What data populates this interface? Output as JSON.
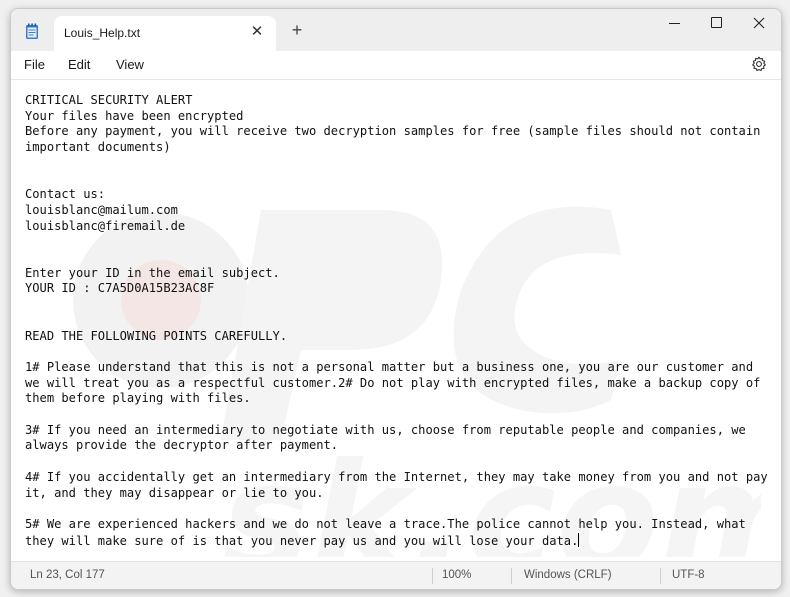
{
  "tab": {
    "title": "Louis_Help.txt"
  },
  "menu": {
    "file": "File",
    "edit": "Edit",
    "view": "View"
  },
  "editor": {
    "lines": [
      "CRITICAL SECURITY ALERT",
      "Your files have been encrypted",
      "Before any payment, you will receive two decryption samples for free (sample files should not contain",
      "important documents)",
      "",
      "",
      "Contact us:",
      "louisblanc@mailum.com",
      "louisblanc@firemail.de",
      "",
      "",
      "Enter your ID in the email subject.",
      "YOUR ID : C7A5D0A15B23AC8F",
      "",
      "",
      "READ THE FOLLOWING POINTS CAREFULLY.",
      "",
      "1# Please understand that this is not a personal matter but a business one, you are our customer and",
      "we will treat you as a respectful customer.2# Do not play with encrypted files, make a backup copy of",
      "them before playing with files.",
      "",
      "3# If you need an intermediary to negotiate with us, choose from reputable people and companies, we",
      "always provide the decryptor after payment.",
      "",
      "4# If you accidentally get an intermediary from the Internet, they may take money from you and not pay",
      "it, and they may disappear or lie to you.",
      "",
      "5# We are experienced hackers and we do not leave a trace.The police cannot help you. Instead, what",
      "they will make sure of is that you never pay us and you will lose your data."
    ]
  },
  "status": {
    "position": "Ln 23, Col 177",
    "zoom": "100%",
    "line_ending": "Windows (CRLF)",
    "encoding": "UTF-8"
  },
  "icons": {
    "app": "notepad-icon",
    "close_tab": "close-icon",
    "new_tab": "plus-icon",
    "settings": "gear-icon"
  },
  "colors": {
    "titlebar": "#eeeeee",
    "editor_bg": "#ffffff",
    "statusbar": "#f3f3f3"
  }
}
